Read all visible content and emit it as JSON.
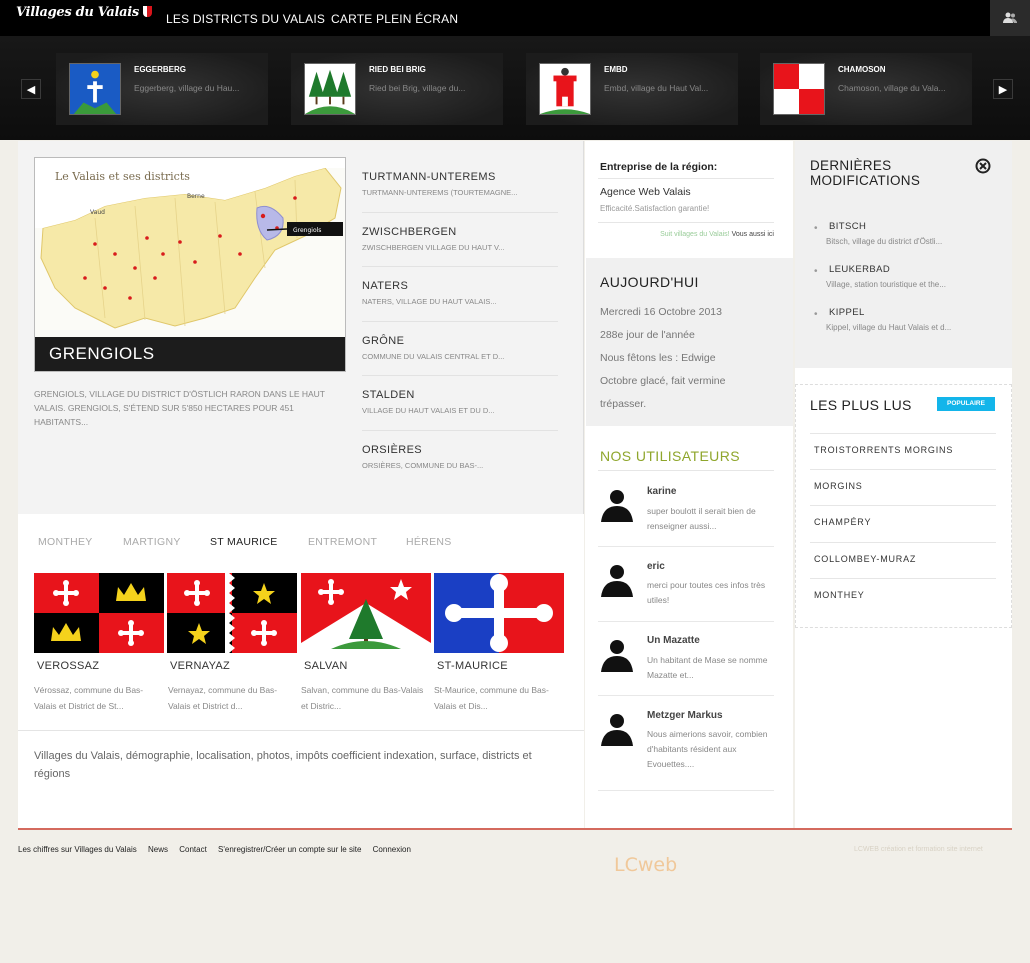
{
  "nav": {
    "logo": "Villages du Valais",
    "links": [
      "LES DISTRICTS DU VALAIS",
      "CARTE PLEIN ÉCRAN"
    ]
  },
  "carousel": {
    "items": [
      {
        "title": "EGGERBERG",
        "desc": "Eggerberg, village du Hau..."
      },
      {
        "title": "RIED BEI BRIG",
        "desc": "Ried bei Brig, village du..."
      },
      {
        "title": "EMBD",
        "desc": "Embd, village du Haut Val..."
      },
      {
        "title": "CHAMOSON",
        "desc": "Chamoson, village du Vala..."
      }
    ]
  },
  "featured": {
    "map_title": "Le Valais et ses districts",
    "map_labels": [
      "Berne",
      "Vaud",
      "Grengiols"
    ],
    "name": "GRENGIOLS",
    "desc": "GRENGIOLS, VILLAGE DU DISTRICT D'ÖSTLICH RARON DANS LE HAUT VALAIS. GRENGIOLS, S'ÉTEND SUR 5'850 HECTARES POUR 451 HABITANTS..."
  },
  "village_list": [
    {
      "title": "TURTMANN-UNTEREMS",
      "desc": "TURTMANN-UNTEREMS (TOURTEMAGNE..."
    },
    {
      "title": "ZWISCHBERGEN",
      "desc": "ZWISCHBERGEN VILLAGE DU HAUT V..."
    },
    {
      "title": "NATERS",
      "desc": "NATERS, VILLAGE DU HAUT VALAIS..."
    },
    {
      "title": "GRÔNE",
      "desc": "COMMUNE DU VALAIS CENTRAL ET D..."
    },
    {
      "title": "STALDEN",
      "desc": "VILLAGE DU HAUT VALAIS ET DU D..."
    },
    {
      "title": "ORSIÈRES",
      "desc": "ORSIÈRES, COMMUNE DU BAS-..."
    }
  ],
  "district_tabs": {
    "tabs": [
      "MONTHEY",
      "MARTIGNY",
      "ST MAURICE",
      "ENTREMONT",
      "HÉRENS"
    ],
    "active": "ST MAURICE"
  },
  "district_villages": [
    {
      "name": "VEROSSAZ",
      "desc": "Vérossaz, commune du Bas-Valais et District de St..."
    },
    {
      "name": "VERNAYAZ",
      "desc": "Vernayaz, commune du Bas-Valais et District d..."
    },
    {
      "name": "SALVAN",
      "desc": "Salvan, commune du Bas-Valais et Distric..."
    },
    {
      "name": "ST-MAURICE",
      "desc": "St-Maurice, commune du Bas-Valais et Dis..."
    }
  ],
  "seo_text": "Villages du Valais, démographie, localisation, photos, impôts coefficient indexation, surface, districts et régions",
  "enterprise": {
    "title": "Entreprise de la région:",
    "name": "Agence Web Valais",
    "tagline": "Efficacité.Satisfaction garantie!",
    "link_green": "Suit villages du Valais!",
    "link_dark": "Vous aussi ici"
  },
  "today": {
    "title": "AUJOURD'HUI",
    "lines": [
      "Mercredi 16 Octobre 2013",
      "288e jour de l'année",
      "Nous fêtons les : Edwige",
      "Octobre glacé, fait vermine",
      "trépasser."
    ]
  },
  "users": {
    "title": "NOS UTILISATEURS",
    "comments": [
      {
        "name": "karine",
        "text": "super boulott il serait bien de renseigner aussi..."
      },
      {
        "name": "eric",
        "text": "merci pour toutes ces infos très utiles!"
      },
      {
        "name": "Un Mazatte",
        "text": "Un habitant de Mase se nomme Mazatte et..."
      },
      {
        "name": "Metzger Markus",
        "text": "Nous aimerions savoir, combien d'habitants résident aux Evouettes...."
      }
    ]
  },
  "recent": {
    "title_line1": "DERNIÈRES",
    "title_line2": "MODIFICATIONS",
    "items": [
      {
        "title": "BITSCH",
        "desc": "Bitsch, village du district d'Östli..."
      },
      {
        "title": "LEUKERBAD",
        "desc": "Village, station touristique et the..."
      },
      {
        "title": "KIPPEL",
        "desc": "Kippel, village du Haut Valais et d..."
      }
    ]
  },
  "most_read": {
    "title": "LES PLUS LUS",
    "badge": "POPULAIRE",
    "items": [
      "TROISTORRENTS MORGINS",
      "MORGINS",
      "CHAMPÉRY",
      "COLLOMBEY-MURAZ",
      "MONTHEY"
    ]
  },
  "footer": {
    "links": [
      "Les chiffres sur Villages du Valais",
      "News",
      "Contact",
      "S'enregistrer/Créer un compte sur le site",
      "Connexion"
    ],
    "right": "LCWEB création et formation site internet",
    "logo": "LCweb"
  },
  "colors": {
    "accent_green": "#8fa62c",
    "badge_blue": "#13b5ea",
    "valais_red": "#e8141b"
  }
}
